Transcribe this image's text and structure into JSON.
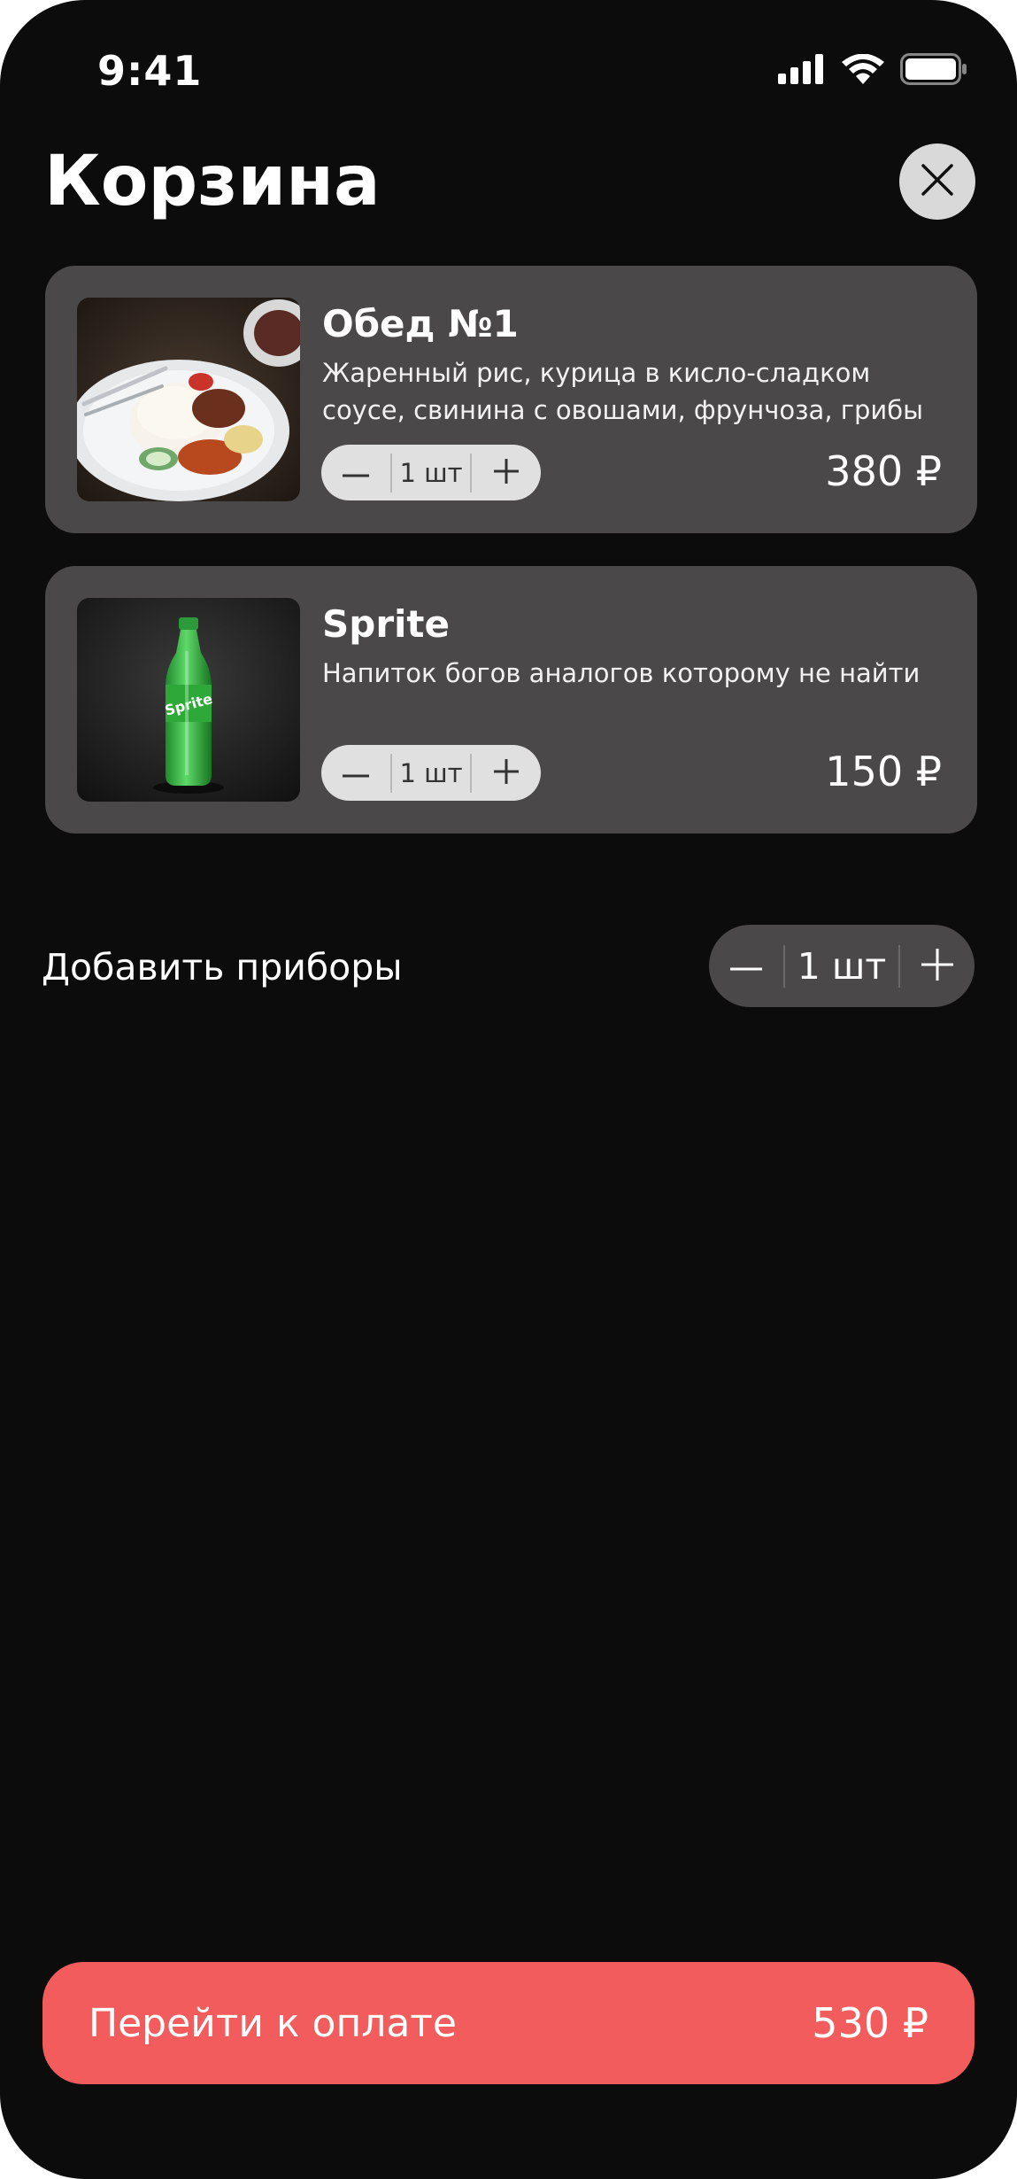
{
  "status_bar": {
    "time": "9:41"
  },
  "header": {
    "title": "Корзина"
  },
  "cart": {
    "items": [
      {
        "name": "Обед №1",
        "description": "Жаренный рис, курица в кисло-сладком соусе, свинина с овошами, фрунчоза, грибы",
        "quantity": "1 шт",
        "price": "380 ₽"
      },
      {
        "name": "Sprite",
        "description": "Напиток богов аналогов которому не найти",
        "quantity": "1 шт",
        "price": "150 ₽"
      }
    ]
  },
  "cutlery": {
    "label": "Добавить приборы",
    "quantity": "1 шт"
  },
  "checkout": {
    "label": "Перейти к оплате",
    "total": "530 ₽",
    "accent_color": "#f25c5c"
  },
  "icons": {
    "close": "close-icon",
    "minus": "minus-icon",
    "plus": "plus-icon",
    "signal": "signal-icon",
    "wifi": "wifi-icon",
    "battery": "battery-icon"
  },
  "colors": {
    "background": "#0c0c0c",
    "card": "#4a4848",
    "stepper_light": "#e0e0e0"
  }
}
